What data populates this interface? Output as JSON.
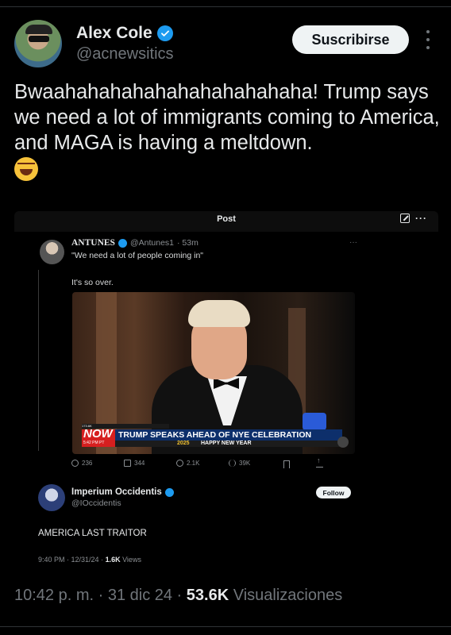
{
  "author": {
    "name": "Alex Cole",
    "handle": "@acnewsitics",
    "subscribe_label": "Suscribirse"
  },
  "tweet": {
    "text": "Bwaahahahahahahahahahahaha! Trump says we need a lot of immigrants coming to America, and MAGA is having a meltdown.",
    "emoji": "rolling-on-floor-laughing"
  },
  "embed": {
    "header_title": "Post",
    "quoted": {
      "name": "ANTUNES",
      "handle": "@Antunes1",
      "time": "· 53m",
      "more": "···",
      "quote": "\"We need a lot of people coming in\"",
      "body": "It's so over."
    },
    "video": {
      "top_strip": "173.6K",
      "now_label": "NOW",
      "time_label": "5:42 PM PT",
      "headline": "TRUMP SPEAKS AHEAD OF NYE CELEBRATION",
      "year": "2025",
      "subline": "HAPPY NEW YEAR"
    },
    "stats": {
      "replies": "236",
      "reposts": "344",
      "likes": "2.1K",
      "views": "39K"
    },
    "reply": {
      "name": "Imperium Occidentis",
      "handle": "@IOccidentis",
      "follow_label": "Follow",
      "text": "AMERICA LAST TRAITOR",
      "time": "9:40 PM · 12/31/24 ·",
      "views_count": "1.6K",
      "views_label": "Views"
    }
  },
  "footer": {
    "time": "10:42 p. m. · 31 dic 24 ·",
    "views_count": "53.6K",
    "views_label": "Visualizaciones"
  },
  "colors": {
    "background": "#000000",
    "verified_blue": "#1d9bf0",
    "muted_text": "#71767b"
  }
}
